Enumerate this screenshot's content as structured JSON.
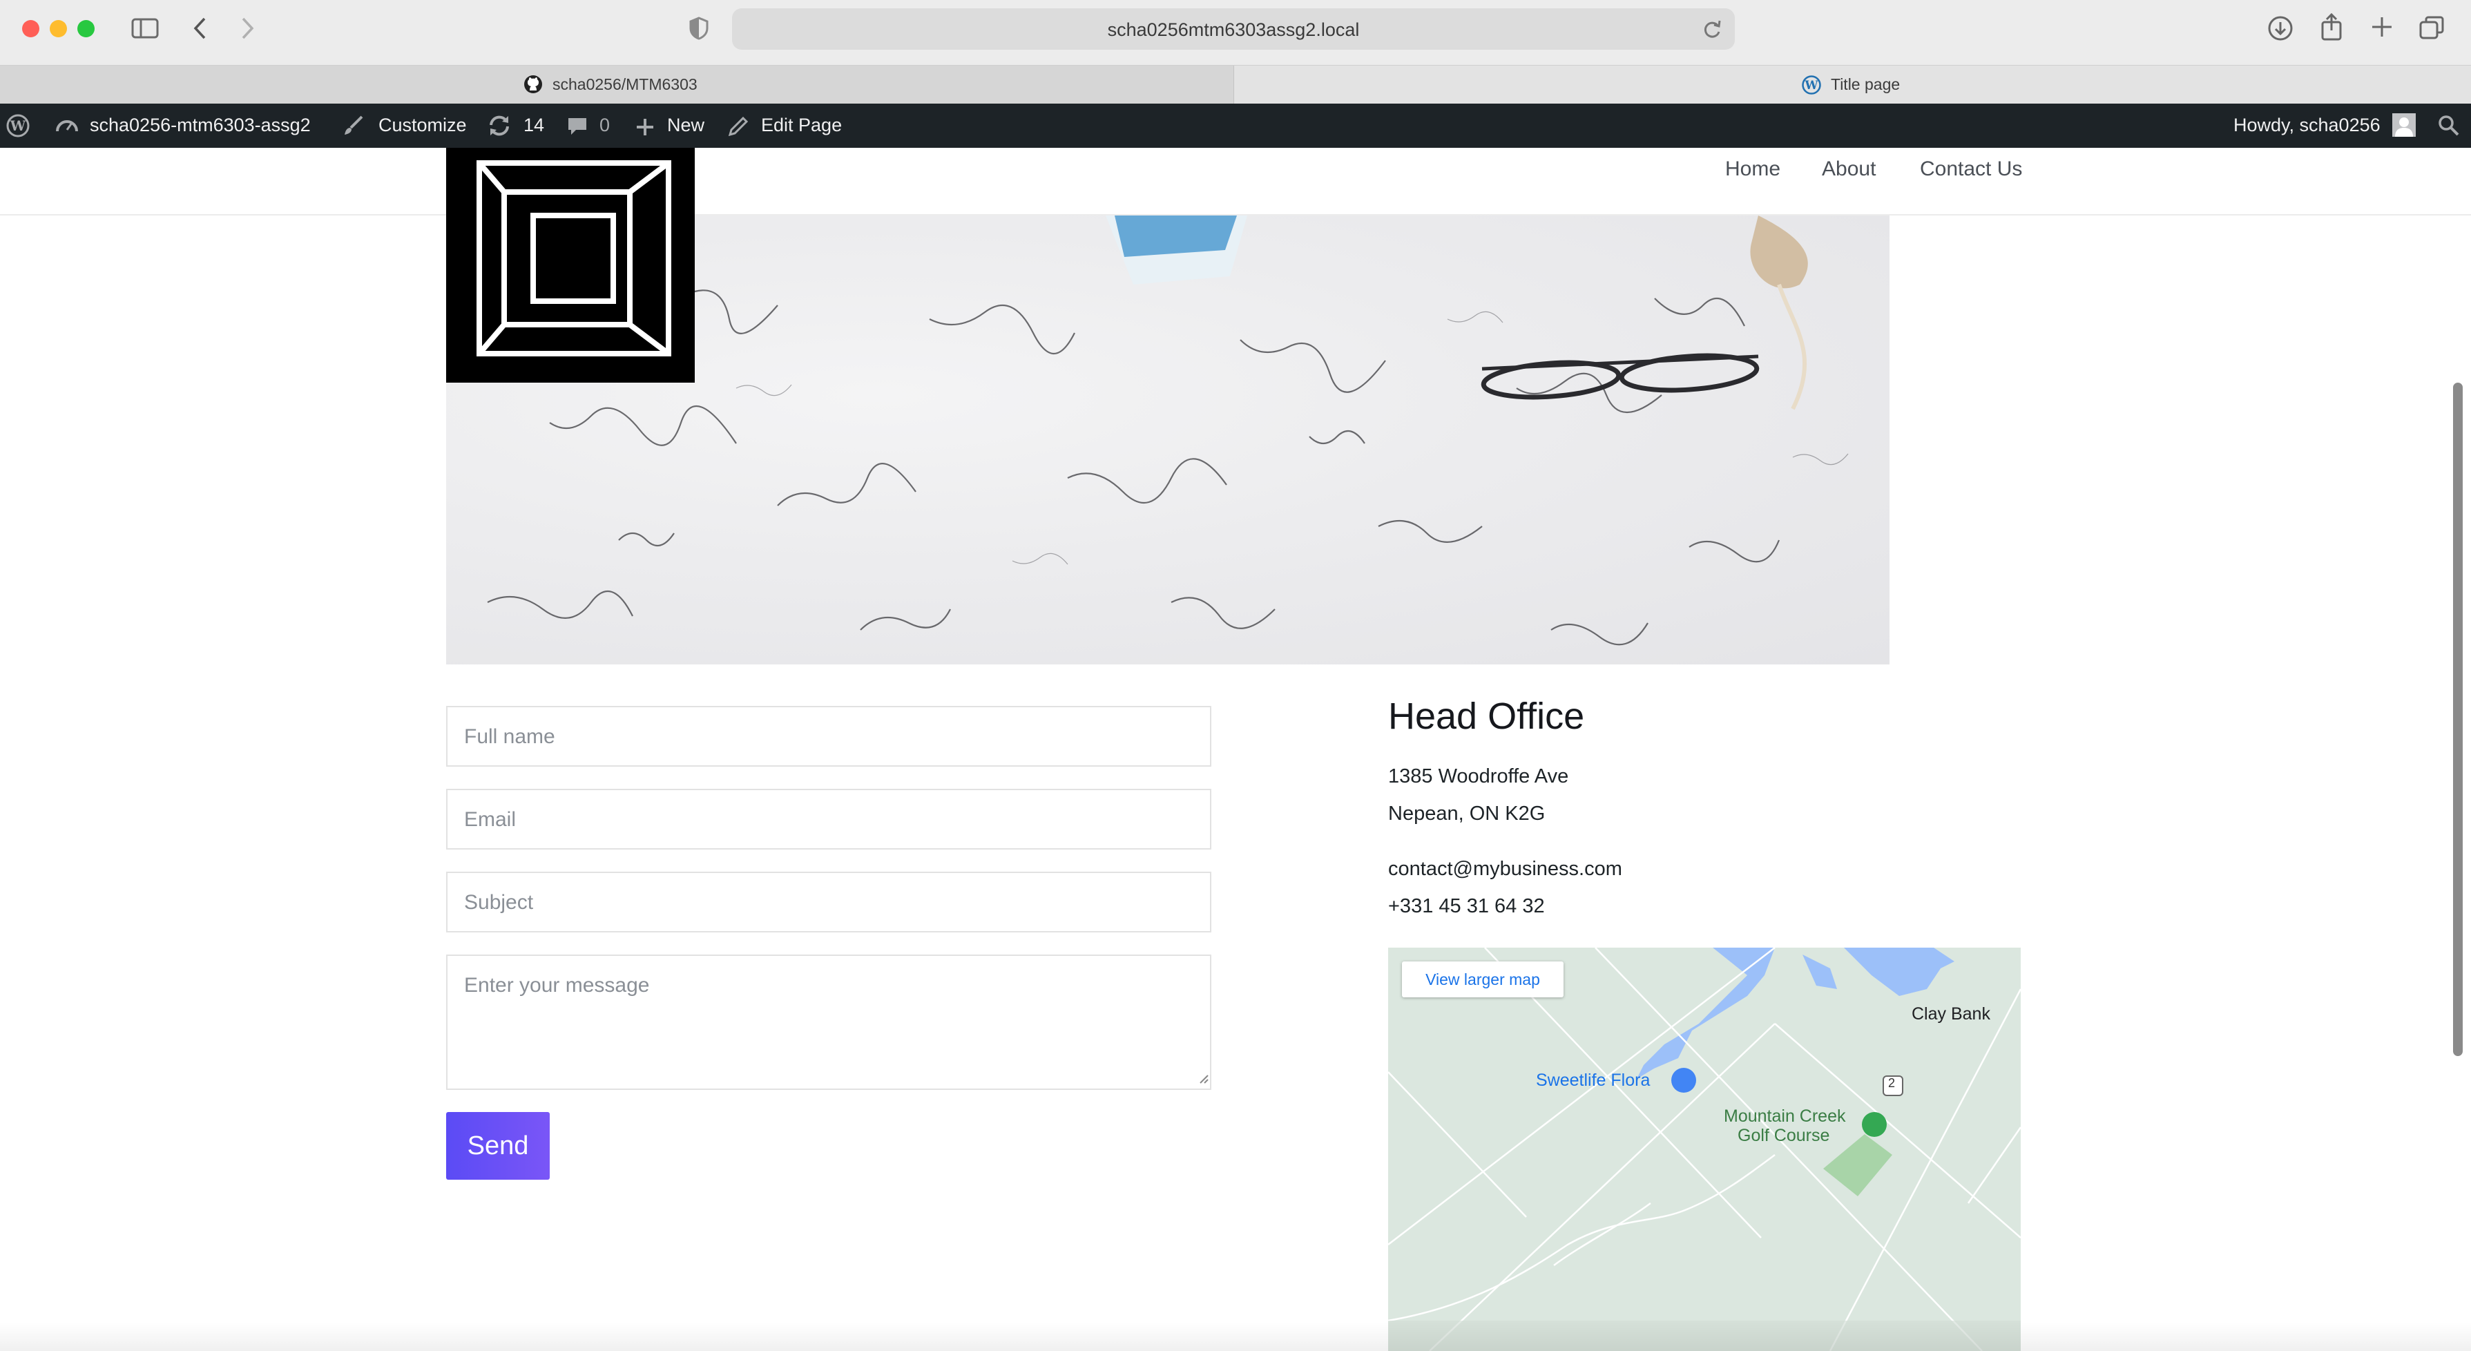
{
  "browser": {
    "url": "scha0256mtm6303assg2.local",
    "tabs": [
      {
        "label": "scha0256/MTM6303",
        "icon": "github-icon"
      },
      {
        "label": "Title page",
        "icon": "wordpress-icon"
      }
    ]
  },
  "adminbar": {
    "site_name": "scha0256-mtm6303-assg2",
    "customize": "Customize",
    "updates_count": "14",
    "comments_count": "0",
    "new_label": "New",
    "edit_label": "Edit Page",
    "howdy": "Howdy, scha0256"
  },
  "nav": {
    "items": [
      "Home",
      "About",
      "Contact Us"
    ]
  },
  "form": {
    "name_placeholder": "Full name",
    "email_placeholder": "Email",
    "subject_placeholder": "Subject",
    "message_placeholder": "Enter your message",
    "send_label": "Send",
    "accent": "#6451f6"
  },
  "office": {
    "title": "Head Office",
    "address_line1": "1385 Woodroffe Ave",
    "address_line2": "Nepean, ON K2G",
    "email": "contact@mybusiness.com",
    "phone": "+331 45 31 64 32"
  },
  "map": {
    "view_larger": "View larger map",
    "labels": {
      "clay_bank": "Clay Bank",
      "sweetlife": "Sweetlife Flora",
      "mountain_creek_1": "Mountain Creek",
      "mountain_creek_2": "Golf Course",
      "route": "2"
    }
  }
}
